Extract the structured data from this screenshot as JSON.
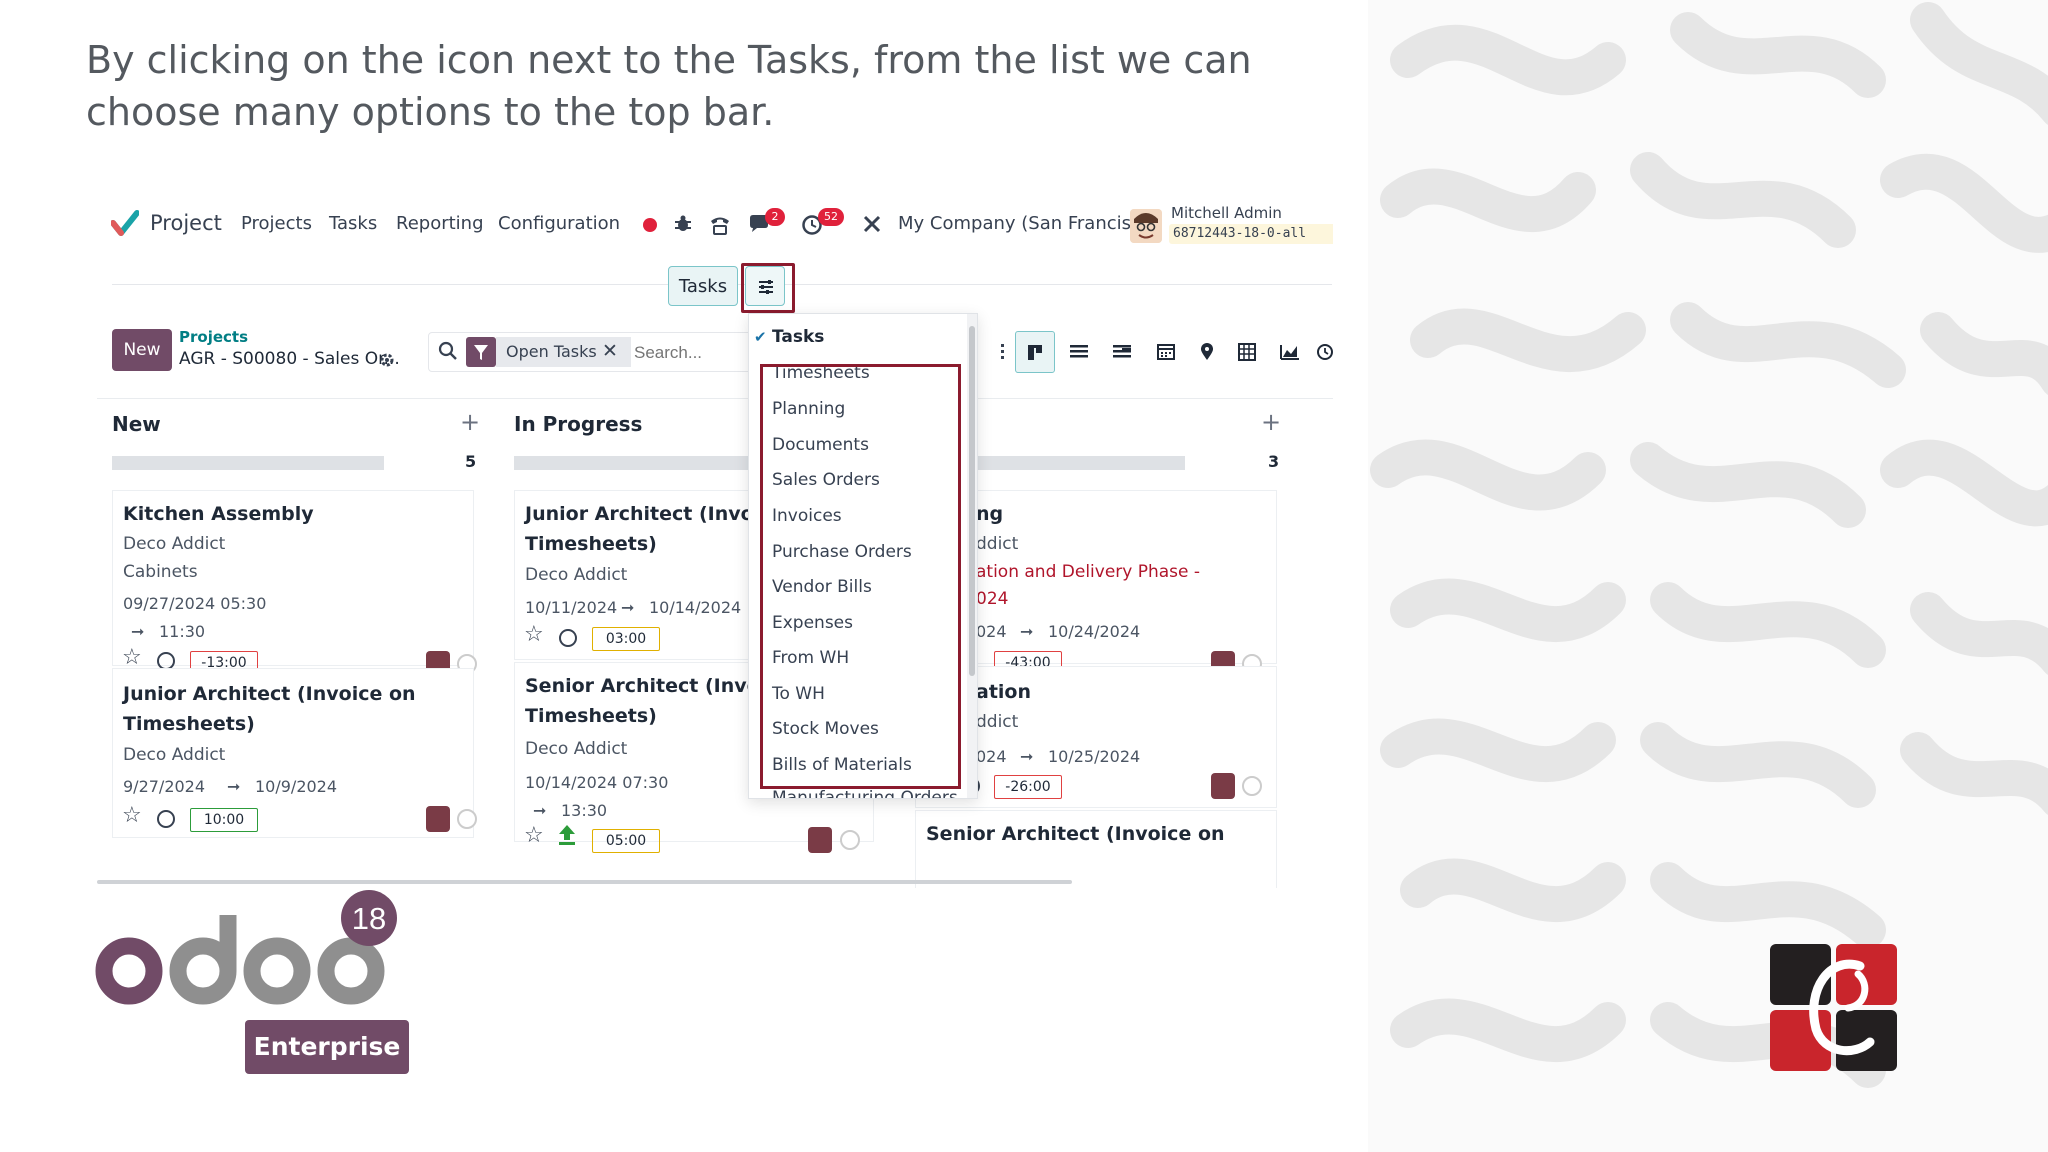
{
  "caption": "By clicking on the icon next to the Tasks, from the list we can choose many options to the top bar.",
  "navbar": {
    "app_name": "Project",
    "menus": [
      "Projects",
      "Tasks",
      "Reporting",
      "Configuration"
    ],
    "chat_badge": "2",
    "activity_badge": "52",
    "company": "My Company (San Francisco)",
    "user_name": "Mitchell Admin",
    "db_name": "68712443-18-0-all"
  },
  "view_switch": {
    "tasks_label": "Tasks"
  },
  "control": {
    "new_label": "New",
    "breadcrumb_parent": "Projects",
    "breadcrumb_current": "AGR - S00080 - Sales Or...",
    "facet_label": "Open Tasks",
    "search_placeholder": "Search..."
  },
  "columns": [
    {
      "title": "New",
      "count": "5"
    },
    {
      "title": "In Progress",
      "count": ""
    },
    {
      "title": "",
      "count": "3"
    }
  ],
  "cards": {
    "new_1": {
      "title": "Kitchen Assembly",
      "customer": "Deco Addict",
      "tag": "Cabinets",
      "date_start": "09/27/2024 05:30",
      "date_end": "11:30",
      "hours": "-13:00"
    },
    "new_2": {
      "title_line1": "Junior Architect (Invoice on",
      "title_line2": "Timesheets)",
      "customer": "Deco Addict",
      "date_start": "9/27/2024",
      "date_end": "10/9/2024",
      "hours": "10:00"
    },
    "prog_1": {
      "title_line1": "Junior Architect (Invoice o",
      "title_line2": "Timesheets)",
      "customer": "Deco Addict",
      "date_start": "10/11/2024",
      "date_end": "10/14/2024",
      "hours": "03:00"
    },
    "prog_2": {
      "title_line1": "Senior Architect (Invoice o",
      "title_line2": "Timesheets)",
      "customer": "Deco Addict",
      "date_start": "10/14/2024 07:30",
      "date_end": "13:30",
      "hours": "05:00"
    },
    "third_1": {
      "title": "ng",
      "customer": "ddict",
      "red_line1": "ation and Delivery Phase -",
      "red_line2": "024",
      "date_start": "024",
      "date_end": "10/24/2024",
      "hours": "-43:00"
    },
    "third_2": {
      "title": "ation",
      "customer": "ddict",
      "date_start": "024",
      "date_end": "10/25/2024",
      "hours": "-26:00"
    },
    "third_3": {
      "title": "Senior Architect (Invoice on"
    }
  },
  "dropdown": {
    "checked_item": "Tasks",
    "items": [
      "Timesheets",
      "Planning",
      "Documents",
      "Sales Orders",
      "Invoices",
      "Purchase Orders",
      "Vendor Bills",
      "Expenses",
      "From WH",
      "To WH",
      "Stock Moves",
      "Bills of Materials",
      "Manufacturing Orders"
    ]
  },
  "branding": {
    "version_badge": "18",
    "logo_word": "odoo",
    "edition": "Enterprise",
    "colors": {
      "odoo_purple": "#714b67",
      "odoo_gray": "#8f8f8f",
      "highlight": "#8b1b2e",
      "accent_teal": "#017e84"
    }
  }
}
